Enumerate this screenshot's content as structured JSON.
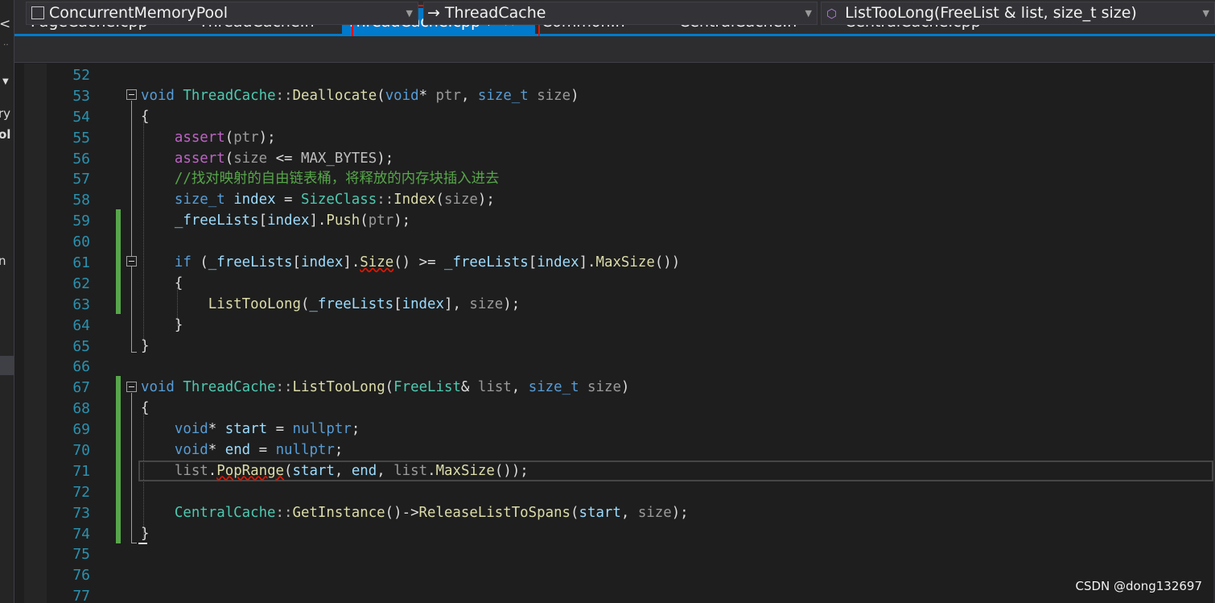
{
  "tabs": {
    "items": [
      "PageCache.cpp",
      "ThreadCache.h",
      "Common.h",
      "CentralCache.h",
      "CentralCache.cpp"
    ],
    "active": "ThreadCache.cpp",
    "pin_glyph": "⊣",
    "close_glyph": "✕"
  },
  "left_panel": {
    "lines": [
      "ry",
      "ol",
      "n"
    ]
  },
  "nav": {
    "project": "ConcurrentMemoryPool",
    "scope": "ThreadCache",
    "member": "ListTooLong(FreeList & list, size_t size)"
  },
  "editor": {
    "line_numbers": [
      52,
      53,
      54,
      55,
      56,
      57,
      58,
      59,
      60,
      61,
      62,
      63,
      64,
      65,
      66,
      67,
      68,
      69,
      70,
      71,
      72,
      73,
      74,
      75,
      76,
      77
    ]
  },
  "watermark": "CSDN @dong132697",
  "colors": {
    "accent": "#007acc",
    "highlight_box": "#e51400",
    "changed_marker": "#57a64a"
  }
}
